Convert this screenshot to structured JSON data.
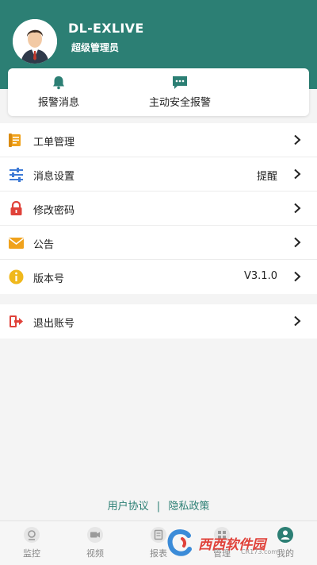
{
  "header": {
    "user_name": "DL-EXLIVE",
    "user_role": "超级管理员"
  },
  "alarm_card": {
    "alarm_messages_label": "报警消息",
    "active_alarm_label": "主动安全报警"
  },
  "menu": {
    "items": [
      {
        "label": "工单管理",
        "value": "",
        "icon": "work-order-icon"
      },
      {
        "label": "消息设置",
        "value": "提醒",
        "icon": "sliders-icon"
      },
      {
        "label": "修改密码",
        "value": "",
        "icon": "lock-icon"
      },
      {
        "label": "公告",
        "value": "",
        "icon": "envelope-icon"
      },
      {
        "label": "版本号",
        "value": "V3.1.0",
        "icon": "info-icon"
      }
    ],
    "logout_label": "退出账号"
  },
  "footer": {
    "user_agreement": "用户协议",
    "separator": "|",
    "privacy_policy": "隐私政策"
  },
  "tabbar": {
    "tabs": [
      {
        "label": "监控",
        "icon": "monitor-icon"
      },
      {
        "label": "视频",
        "icon": "video-icon"
      },
      {
        "label": "报表",
        "icon": "report-icon"
      },
      {
        "label": "管理",
        "icon": "manage-icon"
      },
      {
        "label": "我的",
        "icon": "profile-icon"
      }
    ]
  },
  "watermark": {
    "text": "西西软件园",
    "url": "CR173.com"
  },
  "colors": {
    "primary": "#2c7f74",
    "danger": "#e0423a",
    "warning": "#f0a21c"
  }
}
